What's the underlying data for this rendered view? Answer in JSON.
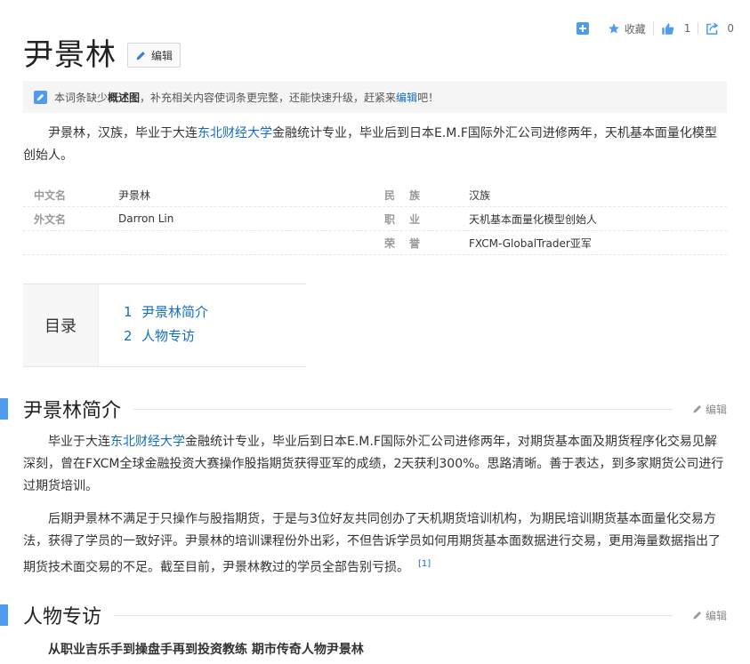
{
  "toolbar": {
    "add_label": "",
    "collect_label": "收藏",
    "like_count": "1",
    "share_count": "0"
  },
  "title": "尹景林",
  "edit_label": "编辑",
  "notice": {
    "pre": "本词条缺少",
    "bold": "概述图",
    "mid": "，补充相关内容使词条更完整，还能快速升级，赶紧来",
    "link": "编辑",
    "post": "吧！"
  },
  "summary": {
    "pre": "尹景林，汉族，毕业于大连",
    "link": "东北财经大学",
    "post": "金融统计专业，毕业后到日本E.M.F国际外汇公司进修两年，天机基本面量化模型创始人。"
  },
  "basic_info": {
    "left": [
      {
        "name": "中文名",
        "value": "尹景林"
      },
      {
        "name": "外文名",
        "value": "Darron Lin"
      },
      {
        "name": "",
        "value": ""
      }
    ],
    "right": [
      {
        "name": "民　族",
        "value": "汉族"
      },
      {
        "name": "职　业",
        "value": "天机基本面量化模型创始人"
      },
      {
        "name": "荣　誉",
        "value": "FXCM-GlobalTrader亚军"
      }
    ]
  },
  "toc": {
    "label": "目录",
    "items": [
      {
        "num": "1",
        "text": "尹景林简介"
      },
      {
        "num": "2",
        "text": "人物专访"
      }
    ]
  },
  "sections": [
    {
      "title": "尹景林简介",
      "edit": "编辑"
    },
    {
      "title": "人物专访",
      "edit": "编辑"
    }
  ],
  "intro_p1": {
    "pre": "毕业于大连",
    "link": "东北财经大学",
    "post": "金融统计专业，毕业后到日本E.M.F国际外汇公司进修两年，对期货基本面及期货程序化交易见解深刻，曾在FXCM全球金融投资大赛操作股指期货获得亚军的成绩，2天获利300%。思路清晰。善于表达，到多家期货公司进行过期货培训。"
  },
  "intro_p2": {
    "text": "后期尹景林不满足于只操作与股指期货，于是与3位好友共同创办了天机期货培训机构，为期民培训期货基本面量化交易方法，获得了学员的一致好评。尹景林的培训课程份外出彩，不但告诉学员如何用期货基本面数据进行交易，更用海量数据指出了期货技术面交易的不足。截至目前，尹景林教过的学员全部告别亏损。",
    "ref": "[1]"
  },
  "interview_title": "从职业吉乐手到操盘手再到投资教练 期市传奇人物尹景林",
  "colors": {
    "link": "#136ec2",
    "accent": "#4f9cee"
  }
}
